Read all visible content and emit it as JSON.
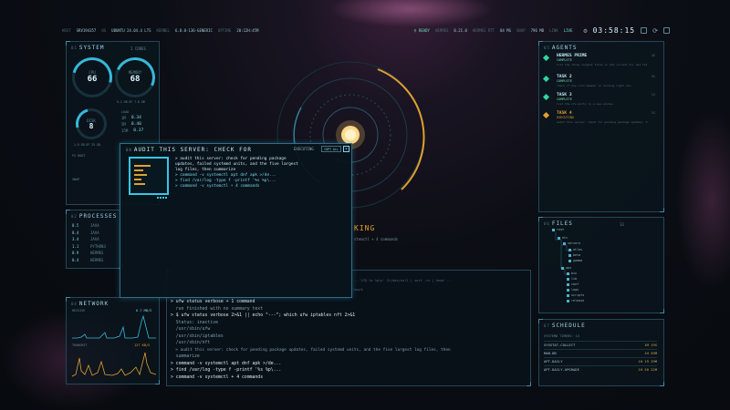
{
  "topbar": {
    "host_label": "HOST",
    "host": "SRV194357",
    "os_label": "OS",
    "os": "UBUNTU 24.04.4 LTS",
    "kernel_label": "KERNEL",
    "kernel": "6.8.0-136-GENERIC",
    "uptime_label": "UPTIME",
    "uptime": "20:12H:45M",
    "ready": "READY",
    "hermes_label": "HERMES",
    "hermes": "0.21.0",
    "rtt_label": "HERMES RTT",
    "rtt": "84 MS",
    "swap_label": "SWAP",
    "swap": "796 MB",
    "link_label": "LINK",
    "link": "LIVE",
    "clock": "03:58:15"
  },
  "system": {
    "num": "01",
    "title": "SYSTEM",
    "cores": "2 CORES",
    "cpu_label": "CPU",
    "cpu": "66",
    "mem_label": "MEMORY",
    "mem": "68",
    "mem_detail": "5.2 GB OF 7.8 GB",
    "disk_label": "DISK",
    "disk": "8",
    "load_label": "LOAD",
    "load": [
      {
        "k": "1M",
        "v": "0.34"
      },
      {
        "k": "5M",
        "v": "0.40"
      },
      {
        "k": "15M",
        "v": "0.37"
      }
    ],
    "disk_detail": "1.9 GB OF 25 GB",
    "fs_label": "FS ROOT",
    "swap_label": "SWAP",
    "cpu_level": 0.66,
    "mem_level": 0.68,
    "disk_level": 0.08
  },
  "processes": {
    "num": "02",
    "title": "PROCESSES",
    "rows": [
      {
        "pct": "8.5",
        "name": "JAVA"
      },
      {
        "pct": "8.4",
        "name": "JAVA"
      },
      {
        "pct": "3.4",
        "name": "JAVA"
      },
      {
        "pct": "1.1",
        "name": "PYTHON3"
      },
      {
        "pct": "0.9",
        "name": "HERMES"
      },
      {
        "pct": "0.4",
        "name": "HERMES"
      }
    ]
  },
  "network": {
    "num": "04",
    "title": "NETWORK",
    "receive_label": "RECEIVE",
    "receive": "6.7 MB/S",
    "transmit_label": "TRANSMIT",
    "transmit": "127 KB/S"
  },
  "agents": {
    "num": "05",
    "title": "AGENTS",
    "items": [
      {
        "name": "HERMES PRIME",
        "status": "COMPLETE",
        "desc": "list the three largest files in the current dir and tell me which one is biggest",
        "ago": "4S",
        "color": "#2fd6a0"
      },
      {
        "name": "TASK 2",
        "status": "COMPLETE",
        "desc": "check if the cron daemon is running right now",
        "ago": "5S",
        "color": "#2fd6a0"
      },
      {
        "name": "TASK 3",
        "status": "COMPLETE",
        "desc": "list the ufw ports in a new window",
        "ago": "1S",
        "color": "#2fd6a0"
      },
      {
        "name": "TASK 4",
        "status": "EXECUTING",
        "desc": "audit this server: check for pending package updates, failed systemd units, and the five largest log files, then summarize",
        "ago": "1S",
        "color": "#e0a030"
      }
    ]
  },
  "files": {
    "num": "06",
    "title": "FILES",
    "count": "13",
    "tree": [
      "root",
      "etc",
      "servers",
      "atlas",
      "beta",
      "gamma",
      "ops",
      "bin",
      "lib",
      "conf",
      "logs",
      "scripts",
      "release"
    ]
  },
  "schedule": {
    "num": "07",
    "title": "SCHEDULE",
    "header": "SYSTEMD TIMERS: 13",
    "rows": [
      {
        "name": "SYSSTAT-COLLECT",
        "time": "1M 19S"
      },
      {
        "name": "MAN-DB",
        "time": "1H 59M"
      },
      {
        "name": "APT-DAILY",
        "time": "1H 19 29M"
      },
      {
        "name": "APT-DAILY-UPGRADE",
        "time": "1H 20 22M"
      }
    ]
  },
  "dialog": {
    "num": "08",
    "title": "AUDIT THIS SERVER: CHECK FOR",
    "status": "EXECUTING",
    "copy": "COPY ALL",
    "close": "×",
    "lines": [
      "> audit this server: check for pending package",
      "updates, failed systemd units, and the five largest",
      "log files, then summarize",
      "> command -v systemctl apt dnf apk >/de...",
      "> find /var/log -type f -printf '%s %p\\...",
      "> command -v systemctl + 4 commands"
    ]
  },
  "hud": {
    "king": "KING",
    "sub": "stemctl + 4 commands"
  },
  "terminal": {
    "top1": "...'%T@ %s %p\\n' 2>/dev/null | sort -rn | head ...",
    "top2": "log/k",
    "lines": [
      {
        "t": "cmd",
        "text": "> ufw status verbose + 1 command"
      },
      {
        "t": "out",
        "text": "  run finished with no summary text"
      },
      {
        "t": "cmd",
        "text": "> $ ufw status verbose 2>&1 || echo \"---\"; which ufw iptables nft 2>&1"
      },
      {
        "t": "out",
        "text": "  Status: inactive"
      },
      {
        "t": "out",
        "text": "  /usr/sbin/ufw"
      },
      {
        "t": "out",
        "text": "  /usr/sbin/iptables"
      },
      {
        "t": "out",
        "text": "  /usr/sbin/nft"
      },
      {
        "t": "out",
        "text": "  > audit this server: check for pending package updates, failed systemd units, and the five largest log files, then"
      },
      {
        "t": "out",
        "text": "  summarize"
      },
      {
        "t": "cmd",
        "text": "> command -v systemctl apt dnf apk >/de..."
      },
      {
        "t": "cmd",
        "text": "> find /var/log -type f -printf '%s %p\\..."
      },
      {
        "t": "cmd",
        "text": "> command -v systemctl + 4 commands"
      }
    ]
  }
}
